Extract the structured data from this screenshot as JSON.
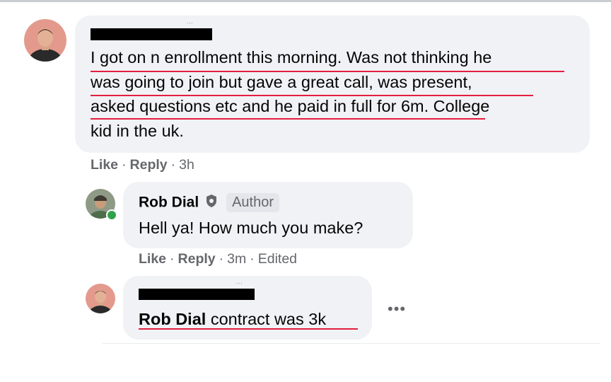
{
  "comment1": {
    "lines": [
      "I got on n enrollment this morning. Was not thinking he",
      "was going to join but gave a great call, was present,",
      "asked questions etc and he paid in full for 6m. College",
      "kid in the uk."
    ],
    "actions": {
      "like": "Like",
      "reply": "Reply",
      "time": "3h"
    }
  },
  "reply1": {
    "author": "Rob Dial",
    "badge_icon": "shield-icon",
    "badge_label": "Author",
    "text": "Hell ya! How much you make?",
    "online": true,
    "actions": {
      "like": "Like",
      "reply": "Reply",
      "time": "3m",
      "edited": "Edited"
    }
  },
  "reply2": {
    "mention": "Rob Dial",
    "text": " contract was 3k",
    "more_label": "•••"
  },
  "separators": {
    "dot": "·"
  },
  "colors": {
    "bubble": "#f0f2f5",
    "underline": "#e41e3f",
    "meta": "#65676b",
    "online": "#31a24c"
  }
}
